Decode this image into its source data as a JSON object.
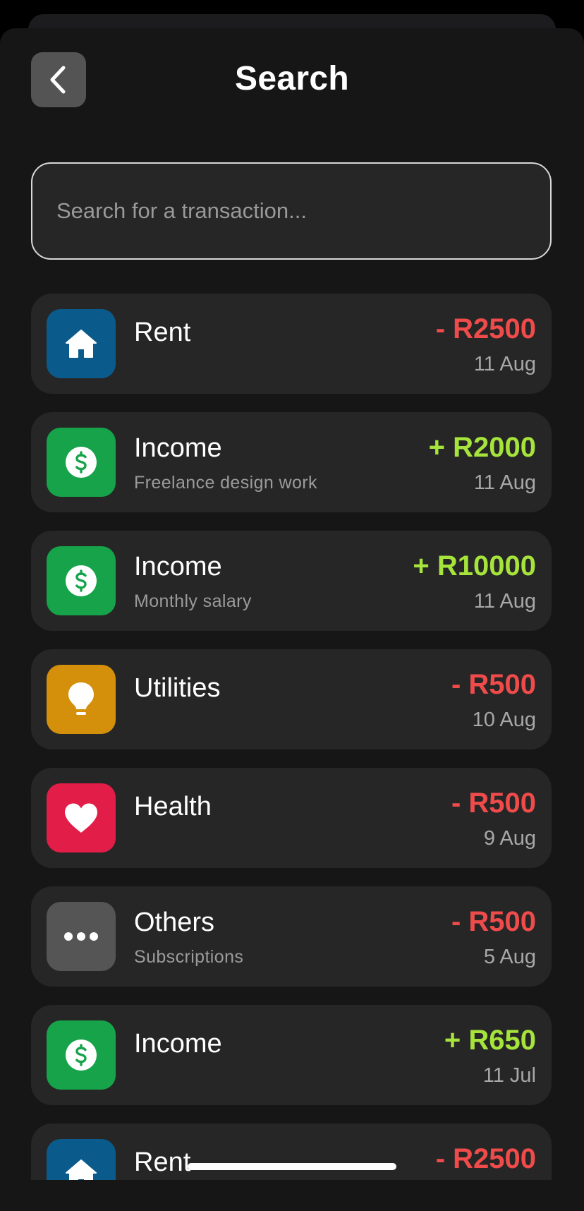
{
  "header": {
    "title": "Search"
  },
  "search": {
    "placeholder": "Search for a transaction...",
    "value": ""
  },
  "colors": {
    "expense": "#f04b4b",
    "income": "#a6e43c",
    "category_home": "#0a5b8c",
    "category_income": "#16a34a",
    "category_utilities": "#d4900a",
    "category_health": "#e11d48",
    "category_others": "#555555"
  },
  "transactions": [
    {
      "category": "Rent",
      "note": "",
      "amount": "- R2500",
      "date": "11 Aug",
      "type": "expense",
      "icon": "home-icon"
    },
    {
      "category": "Income",
      "note": "Freelance design work",
      "amount": "+ R2000",
      "date": "11 Aug",
      "type": "income",
      "icon": "dollar-icon"
    },
    {
      "category": "Income",
      "note": "Monthly salary",
      "amount": "+ R10000",
      "date": "11 Aug",
      "type": "income",
      "icon": "dollar-icon"
    },
    {
      "category": "Utilities",
      "note": "",
      "amount": "- R500",
      "date": "10 Aug",
      "type": "expense",
      "icon": "lightbulb-icon"
    },
    {
      "category": "Health",
      "note": "",
      "amount": "- R500",
      "date": "9 Aug",
      "type": "expense",
      "icon": "heart-icon"
    },
    {
      "category": "Others",
      "note": "Subscriptions",
      "amount": "- R500",
      "date": "5 Aug",
      "type": "expense",
      "icon": "more-dots-icon"
    },
    {
      "category": "Income",
      "note": "",
      "amount": "+ R650",
      "date": "11 Jul",
      "type": "income",
      "icon": "dollar-icon"
    },
    {
      "category": "Rent",
      "note": "",
      "amount": "- R2500",
      "date": "",
      "type": "expense",
      "icon": "home-icon"
    }
  ]
}
